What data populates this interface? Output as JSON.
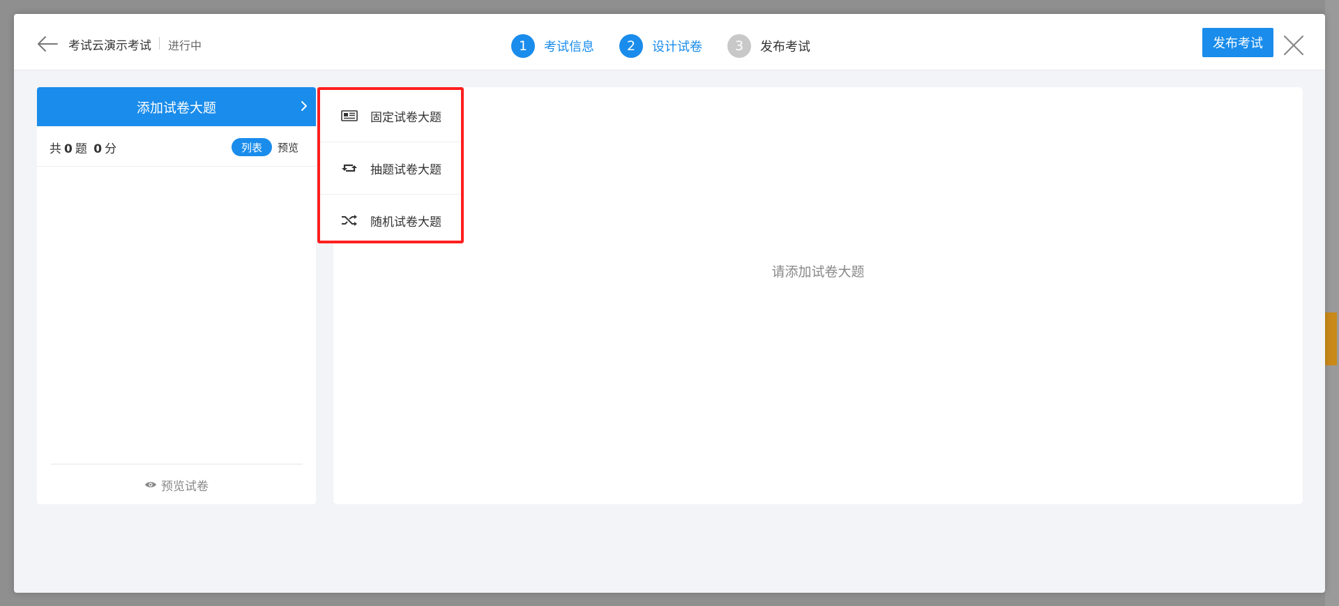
{
  "header": {
    "title": "考试云演示考试",
    "status": "进行中",
    "steps": [
      {
        "num": "1",
        "label": "考试信息",
        "state": "done"
      },
      {
        "num": "2",
        "label": "设计试卷",
        "state": "active"
      },
      {
        "num": "3",
        "label": "发布考试",
        "state": "pending"
      }
    ],
    "publish_label": "发布考试"
  },
  "left_panel": {
    "add_section_label": "添加试卷大题",
    "count_prefix": "共",
    "question_count": "0",
    "question_unit": "题",
    "score_count": "0",
    "score_unit": "分",
    "view_list_label": "列表",
    "view_preview_label": "预览",
    "preview_paper_label": "预览试卷"
  },
  "dropdown": {
    "items": [
      {
        "label": "固定试卷大题",
        "icon": "newspaper-icon"
      },
      {
        "label": "抽题试卷大题",
        "icon": "retweet-icon"
      },
      {
        "label": "随机试卷大题",
        "icon": "shuffle-icon"
      }
    ]
  },
  "main": {
    "empty_message": "请添加试卷大题"
  },
  "colors": {
    "accent": "#1a8ceb",
    "highlight_border": "#ff1f1f",
    "inactive_step": "#c8c8c8"
  }
}
